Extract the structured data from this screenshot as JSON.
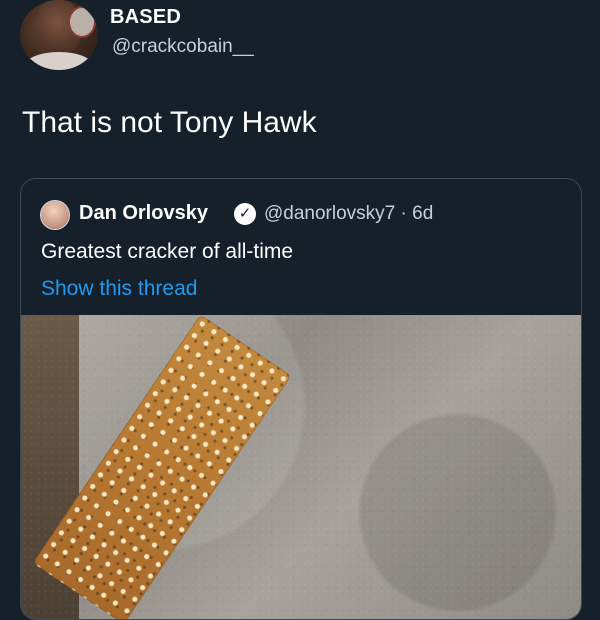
{
  "tweet": {
    "author": {
      "name": "BASED",
      "handle": "@crackcobain__"
    },
    "text": "That is not Tony Hawk",
    "quote": {
      "author_name": "Dan Orlovsky",
      "handle_time": "@danorlovsky7 · 6d",
      "text": "Greatest cracker of all-time",
      "link": "Show this thread"
    }
  },
  "icons": {
    "verified": "verified-badge-icon"
  },
  "colors": {
    "background": "#15202b",
    "link": "#1d9bf0",
    "muted_text": "#c7d0d9",
    "border": "#3b4a59"
  }
}
